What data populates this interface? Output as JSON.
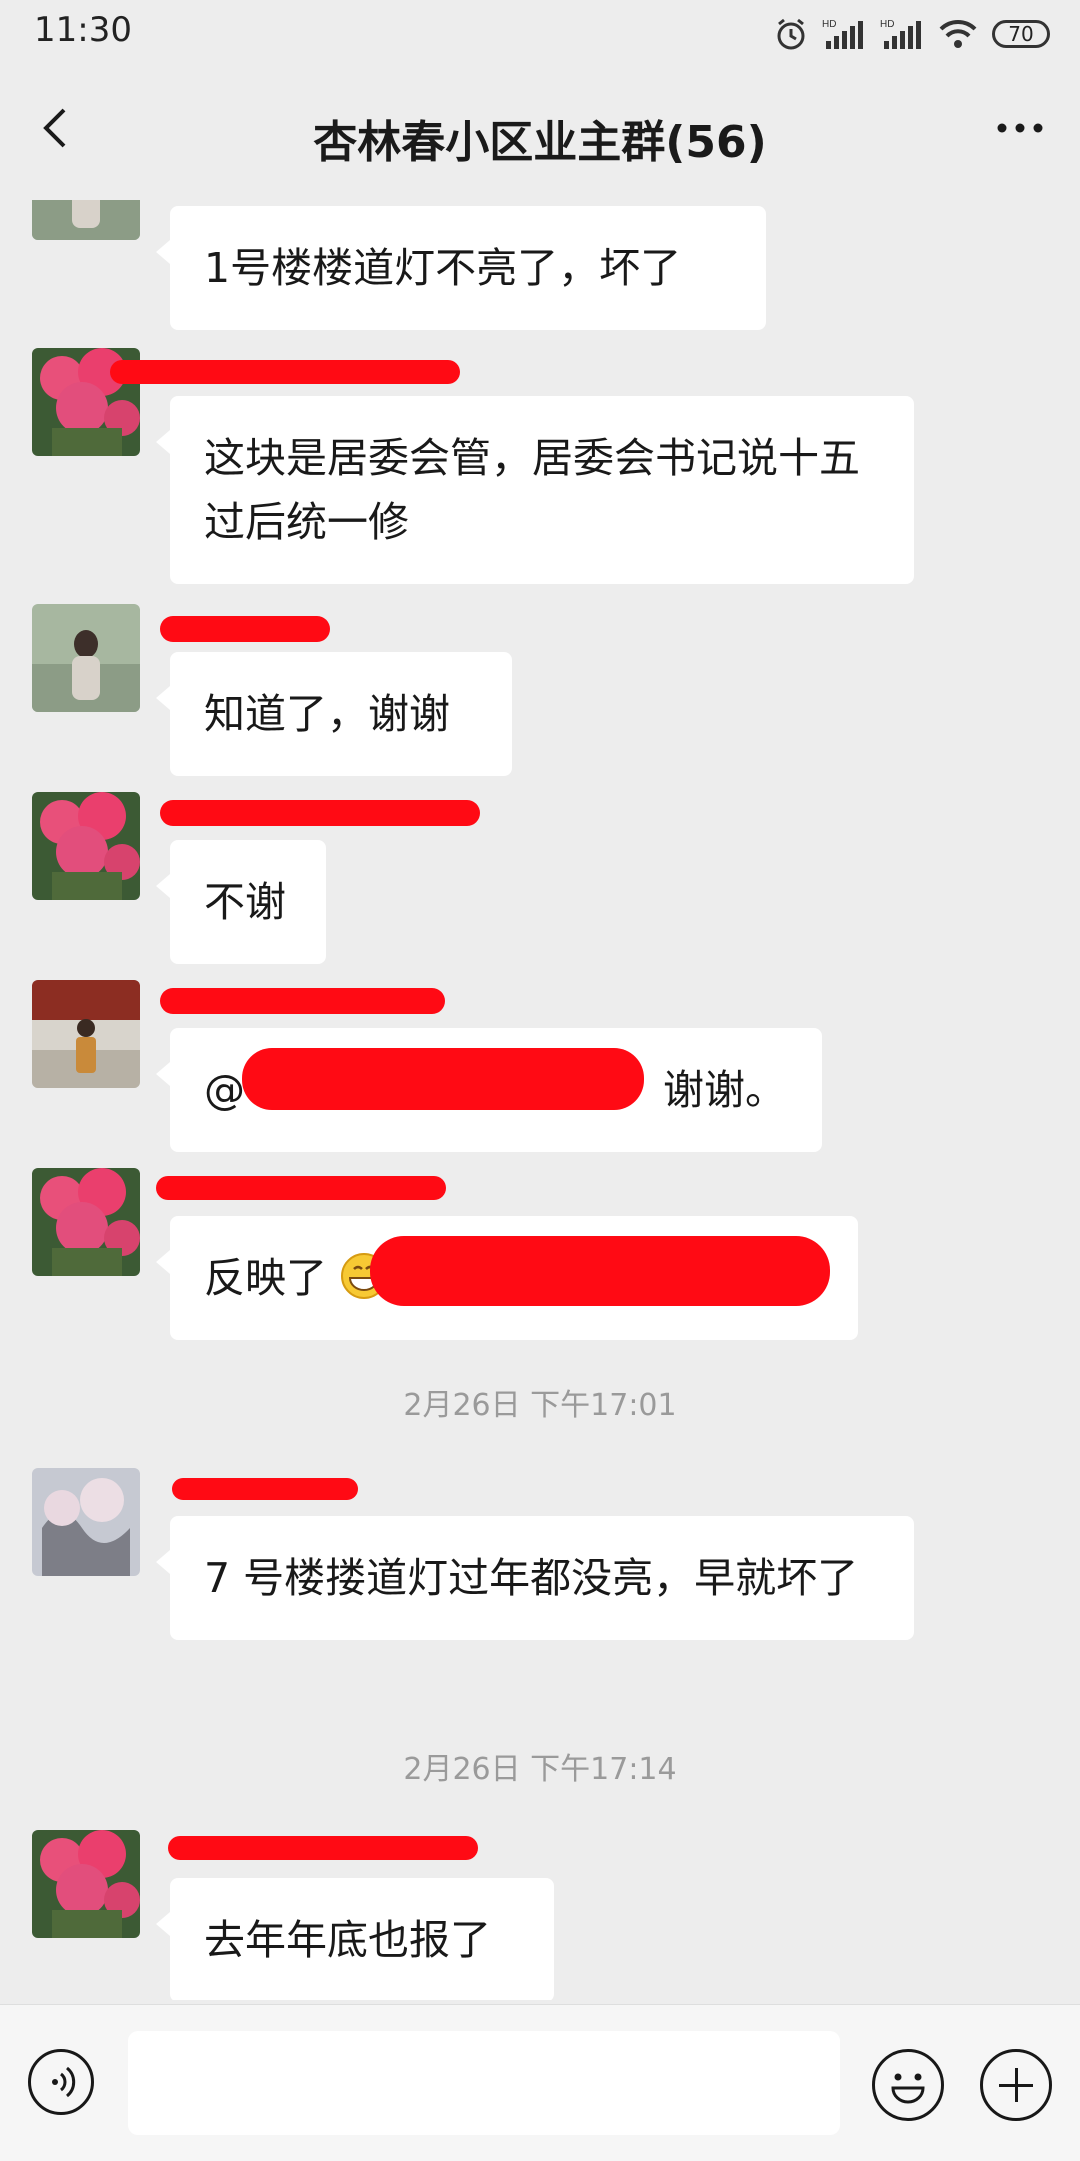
{
  "status_bar": {
    "time": "11:30",
    "battery": "70"
  },
  "header": {
    "title": "杏林春小区业主群(56)"
  },
  "messages": [
    {
      "text": "1号楼楼道灯不亮了，坏了"
    },
    {
      "text": "这块是居委会管，居委会书记说十五过后统一修"
    },
    {
      "text": "知道了，谢谢"
    },
    {
      "text": "不谢"
    },
    {
      "prefix": "@",
      "suffix": "谢谢。"
    },
    {
      "text": "反映了"
    },
    {
      "text": "7 号楼搂道灯过年都没亮，早就坏了"
    },
    {
      "text": "去年年底也报了"
    }
  ],
  "timestamps": [
    "2月26日 下午17:01",
    "2月26日 下午17:14"
  ],
  "icons": {
    "back": "chevron-left-icon",
    "more": "more-dots-icon",
    "voice": "voice-icon",
    "emoji": "emoji-icon",
    "plus": "plus-icon"
  },
  "colors": {
    "background": "#ededed",
    "bubble": "#ffffff",
    "redaction": "#ff0a14"
  }
}
